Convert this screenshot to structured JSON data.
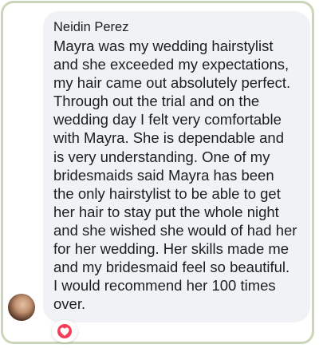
{
  "comment": {
    "author": "Neidin Perez",
    "text": "Mayra was my wedding hairstylist\nand she exceeded my expectations,\nmy hair came out absolutely perfect.\nThrough out the trial and on the\nwedding day I felt very comfortable\nwith Mayra. She is dependable and\nis very understanding. One of my\nbridesmaids said Mayra has been\nthe only hairstylist to be able to get\nher hair to stay put the whole night\nand she wished she would of had her\nfor her wedding. Her skills made me\nand my bridesmaid feel so beautiful.\nI would recommend her 100 times\nover."
  },
  "reaction": {
    "icon": "heart-icon",
    "color": "#f33e58"
  }
}
